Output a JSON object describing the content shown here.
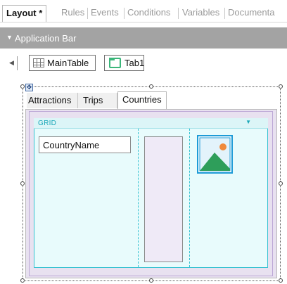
{
  "editor_tabs": [
    {
      "label": "Layout *",
      "active": true
    },
    {
      "label": "Rules",
      "active": false
    },
    {
      "label": "Events",
      "active": false
    },
    {
      "label": "Conditions",
      "active": false
    },
    {
      "label": "Variables",
      "active": false
    },
    {
      "label": "Documenta",
      "active": false
    }
  ],
  "app_bar": {
    "label": "Application Bar",
    "icon": "chevron-down-icon"
  },
  "breadcrumb": {
    "main_table": "MainTable",
    "tab": "Tab1"
  },
  "tab_control": {
    "tabs": [
      "Attractions",
      "Trips",
      "Countries"
    ],
    "active_index": 2
  },
  "grid": {
    "label": "GRID",
    "field": "CountryName"
  },
  "colors": {
    "grid_border": "#36c2d1",
    "panel_bg": "#e8e1f0",
    "image_frame": "#1e9bd7",
    "image_hill": "#2e9e5a",
    "image_sun": "#f08a3c",
    "tab_icon": "#3bb67a"
  }
}
